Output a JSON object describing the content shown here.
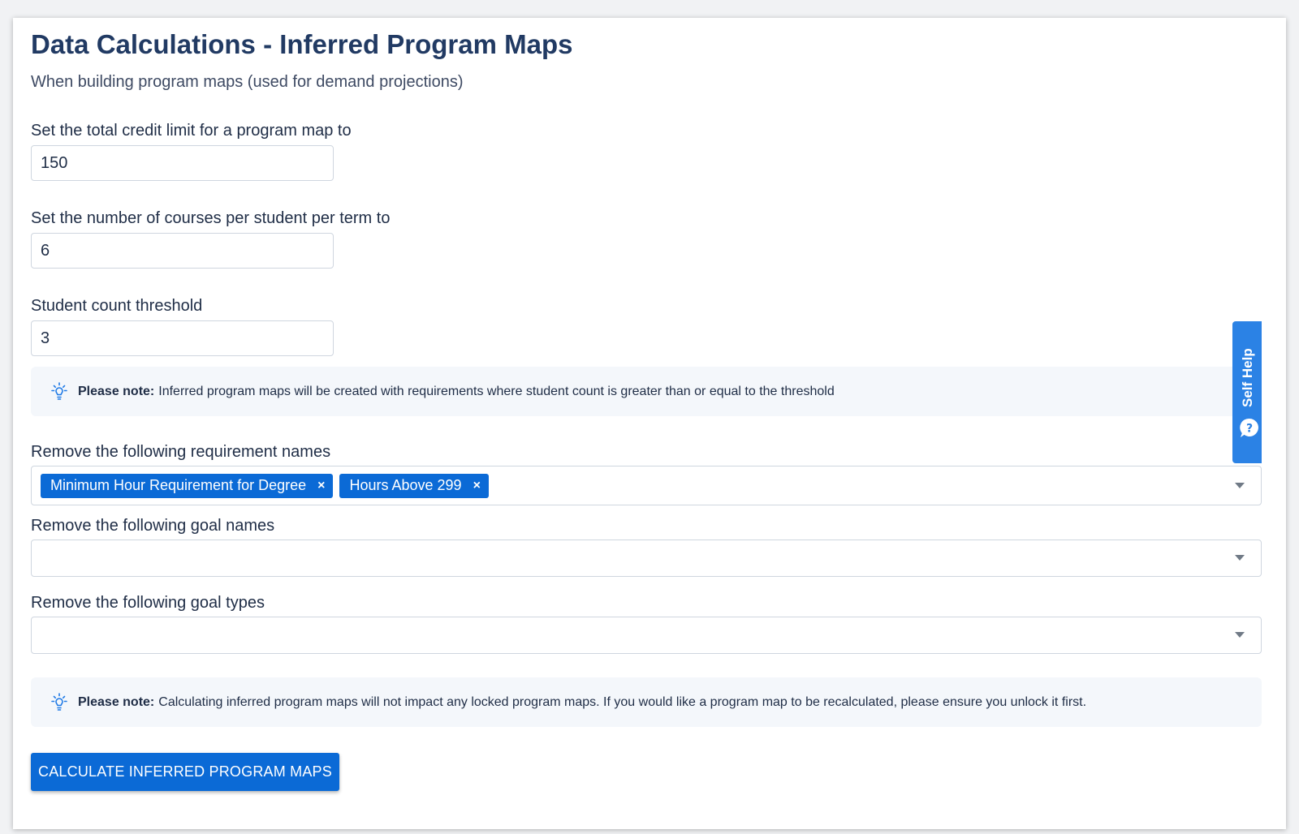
{
  "page": {
    "title": "Data Calculations - Inferred Program Maps",
    "subtitle": "When building program maps (used for demand projections)"
  },
  "fields": {
    "credit_limit": {
      "label": "Set the total credit limit for a program map to",
      "value": "150"
    },
    "courses_per_term": {
      "label": "Set the number of courses per student per term to",
      "value": "6"
    },
    "student_threshold": {
      "label": "Student count threshold",
      "value": "3"
    }
  },
  "notes": {
    "threshold": {
      "prefix": "Please note:",
      "text": "Inferred program maps will be created with requirements where student count is greater than or equal to the threshold"
    },
    "locked": {
      "prefix": "Please note:",
      "text": "Calculating inferred program maps will not impact any locked program maps. If you would like a program map to be recalculated, please ensure you unlock it first."
    }
  },
  "selects": {
    "requirement_names": {
      "label": "Remove the following requirement names",
      "selected": [
        "Minimum Hour Requirement for Degree",
        "Hours Above 299"
      ],
      "remove_glyph": "×"
    },
    "goal_names": {
      "label": "Remove the following goal names",
      "selected": []
    },
    "goal_types": {
      "label": "Remove the following goal types",
      "selected": []
    }
  },
  "actions": {
    "calculate_label": "CALCULATE INFERRED PROGRAM MAPS"
  },
  "self_help": {
    "label": "Self Help",
    "icon": "question-chat-icon"
  },
  "colors": {
    "primary": "#0b6ad6",
    "title": "#213a63",
    "self_help": "#2b82e5",
    "note_bg": "#f4f7fb"
  }
}
